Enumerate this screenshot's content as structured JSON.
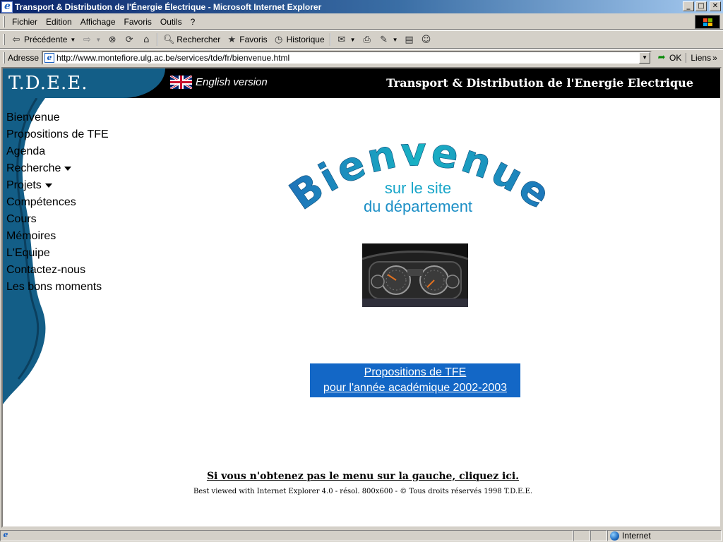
{
  "window": {
    "title": "Transport & Distribution de l'Énergie Électrique - Microsoft Internet Explorer",
    "minimize": "_",
    "maximize": "□",
    "close": "✕"
  },
  "menu": [
    "Fichier",
    "Edition",
    "Affichage",
    "Favoris",
    "Outils",
    "?"
  ],
  "toolbar": {
    "back": "Précédente",
    "search": "Rechercher",
    "favorites": "Favoris",
    "history": "Historique"
  },
  "address": {
    "label": "Adresse",
    "url": "http://www.montefiore.ulg.ac.be/services/tde/fr/bienvenue.html",
    "go": "OK",
    "links": "Liens"
  },
  "page": {
    "logo": "T.D.E.E.",
    "english": "English version",
    "site_title": "Transport & Distribution de l'Energie Electrique",
    "nav": [
      {
        "label": "Bienvenue",
        "dropdown": false
      },
      {
        "label": "Propositions de TFE",
        "dropdown": false
      },
      {
        "label": "Agenda",
        "dropdown": false
      },
      {
        "label": "Recherche",
        "dropdown": true
      },
      {
        "label": "Projets",
        "dropdown": true
      },
      {
        "label": "Compétences",
        "dropdown": false
      },
      {
        "label": "Cours",
        "dropdown": false
      },
      {
        "label": "Mémoires",
        "dropdown": false
      },
      {
        "label": "L'Equipe",
        "dropdown": false
      },
      {
        "label": "Contactez-nous",
        "dropdown": false
      },
      {
        "label": "Les bons moments",
        "dropdown": false
      }
    ],
    "welcome": {
      "big": "Bienvenue",
      "line1": "sur le site",
      "line2": "du département"
    },
    "tfe": {
      "line1": "Propositions de TFE",
      "line2": "pour l'année académique 2002-2003"
    },
    "menu_link": "Si vous n'obtenez pas le menu sur la gauche, cliquez ici.",
    "footer": "Best viewed with Internet Explorer 4.0 - résol. 800x600 - © Tous droits réservés 1998 T.D.E.E."
  },
  "status": {
    "zone": "Internet"
  },
  "colors": {
    "header_bg": "#000000",
    "wave": "#135e87",
    "tfe_bg": "#1367c6",
    "welcome_gradient": [
      "#1e6fb8",
      "#19b3c4"
    ]
  }
}
